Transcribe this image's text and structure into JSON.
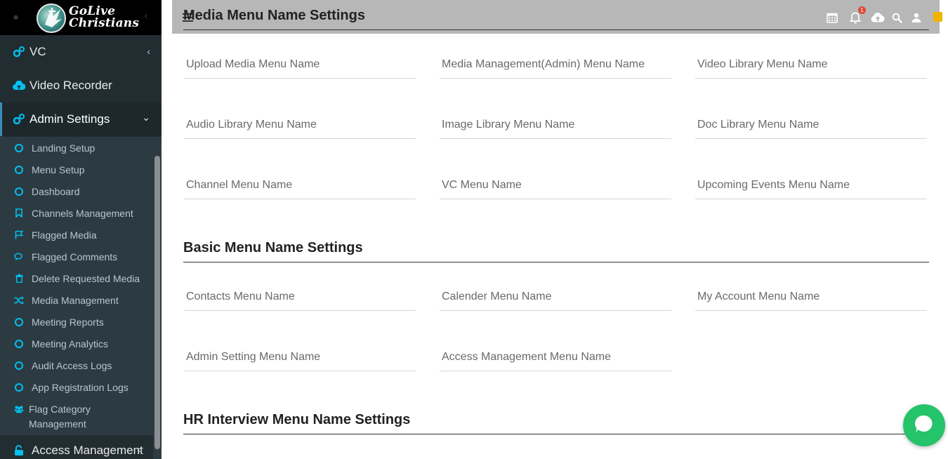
{
  "brand": {
    "line1": "GoLive",
    "line2": "Christians"
  },
  "sidebar": {
    "items": [
      {
        "label": "VC",
        "icon": "cogs-icon"
      },
      {
        "label": "Video Recorder",
        "icon": "cloud-upload-icon"
      },
      {
        "label": "Admin Settings",
        "icon": "cogs-icon"
      }
    ],
    "admin_sub": [
      {
        "label": "Landing Setup",
        "icon": "circle-icon"
      },
      {
        "label": "Menu Setup",
        "icon": "circle-icon"
      },
      {
        "label": "Dashboard",
        "icon": "circle-icon"
      },
      {
        "label": "Channels Management",
        "icon": "bookmark-icon"
      },
      {
        "label": "Flagged Media",
        "icon": "flag-icon"
      },
      {
        "label": "Flagged Comments",
        "icon": "comments-icon"
      },
      {
        "label": "Delete Requested Media",
        "icon": "trash-icon"
      },
      {
        "label": "Media Management",
        "icon": "random-icon"
      },
      {
        "label": "Meeting Reports",
        "icon": "circle-icon"
      },
      {
        "label": "Meeting Analytics",
        "icon": "circle-icon"
      },
      {
        "label": "Audit Access Logs",
        "icon": "circle-icon"
      },
      {
        "label": "App Registration Logs",
        "icon": "circle-icon"
      },
      {
        "label": "Flag Category Management",
        "icon": "users-icon"
      }
    ],
    "access_management": {
      "label": "Access Management",
      "icon": "unlock-icon"
    }
  },
  "topbar": {
    "notification_count": "1",
    "icons": [
      "calendar-icon",
      "bell-icon",
      "cloud-upload-icon",
      "search-icon",
      "user-icon"
    ]
  },
  "sections": {
    "media": {
      "title": "Media Menu Name Settings",
      "fields": [
        "Upload Media Menu Name",
        "Media Management(Admin) Menu Name",
        "Video Library Menu Name",
        "Audio Library Menu Name",
        "Image Library Menu Name",
        "Doc Library Menu Name",
        "Channel Menu Name",
        "VC Menu Name",
        "Upcoming Events Menu Name"
      ]
    },
    "basic": {
      "title": "Basic Menu Name Settings",
      "fields": [
        "Contacts Menu Name",
        "Calender Menu Name",
        "My Account Menu Name",
        "Admin Setting Menu Name",
        "Access Management Menu Name"
      ]
    },
    "hr": {
      "title": "HR Interview Menu Name Settings"
    }
  },
  "colors": {
    "sidebar_bg": "#222d32",
    "submenu_bg": "#2c3b41",
    "accent": "#00c0ef",
    "topbar_bg": "#b7b7b7",
    "chat_green": "#25c36a"
  }
}
